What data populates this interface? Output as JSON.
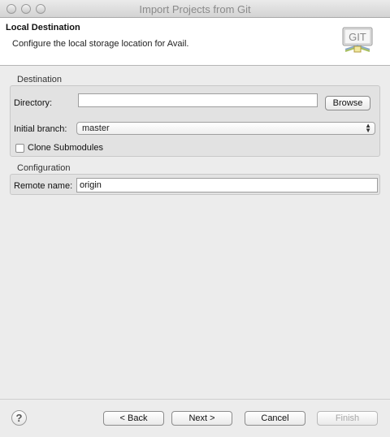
{
  "window": {
    "title": "Import Projects from Git"
  },
  "header": {
    "title": "Local Destination",
    "description": "Configure the local storage location for Avail.",
    "logo_text": "GIT",
    "logo_icon": "git-logo-icon"
  },
  "destination": {
    "group_label": "Destination",
    "directory_label": "Directory:",
    "directory_value": "",
    "browse_label": "Browse",
    "branch_label": "Initial branch:",
    "branch_value": "master",
    "clone_submodules_label": "Clone Submodules",
    "clone_submodules_checked": false
  },
  "configuration": {
    "group_label": "Configuration",
    "remote_name_label": "Remote name:",
    "remote_name_value": "origin"
  },
  "footer": {
    "help_icon": "help-icon",
    "help_glyph": "?",
    "back_label": "< Back",
    "next_label": "Next >",
    "cancel_label": "Cancel",
    "finish_label": "Finish"
  }
}
